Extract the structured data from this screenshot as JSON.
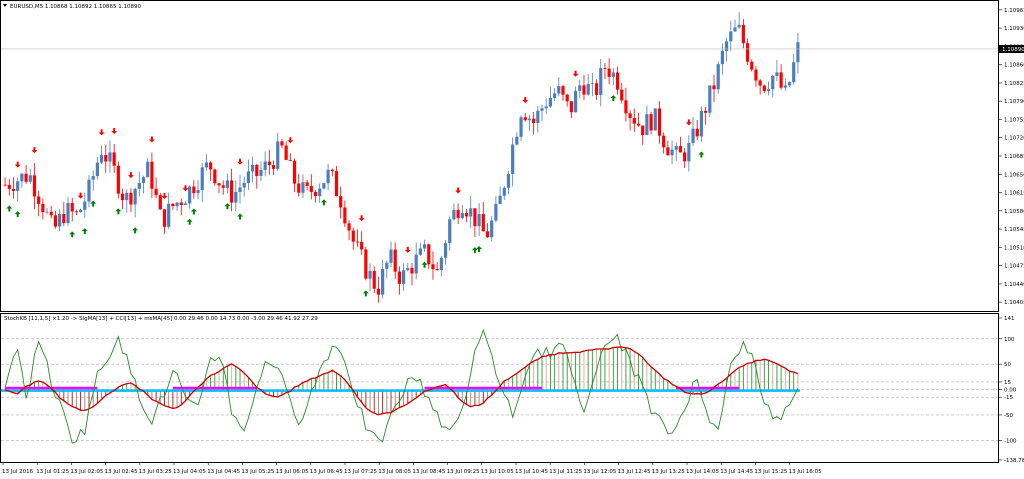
{
  "colors": {
    "bull": "#4a7ebf",
    "bear": "#ff0000",
    "up_arrow": "#008000",
    "down_arrow": "#ff0000",
    "grid": "#9a9a9a",
    "stoch": "#cc0000",
    "cci": "#2a8a2a",
    "hist_pos": "#2e9a2e",
    "hist_neg": "#c01010",
    "signal_pink": "#ff00ff",
    "signal_cyan": "#00bfff",
    "price_tag": "#000000"
  },
  "main": {
    "title": "EURUSD,M5  1.10868 1.10892 1.10865 1.10890",
    "current_price_label": "1.10890",
    "current_price": 1.1089
  },
  "sub": {
    "title": "StochKB [11,1,5] ×1.20 -> SigMA[13] + CCI[13] + msMA[45] 0.00 29.46 0.00 14.73 0.00 -3.00 29.46 41.92 27.29"
  },
  "chart_data": [
    {
      "type": "candlestick",
      "symbol": "EURUSD,M5",
      "ylim": [
        1.1039,
        1.1098
      ],
      "y_tick_labels": [
        "1.10965",
        "1.10930",
        "1.10895",
        "1.10860",
        "1.10825",
        "1.10790",
        "1.10755",
        "1.10720",
        "1.10685",
        "1.10650",
        "1.10615",
        "1.10580",
        "1.10545",
        "1.10510",
        "1.10475",
        "1.10440",
        "1.10405"
      ],
      "close_path": [
        1.1063,
        1.1064,
        1.1065,
        1.106,
        1.1054,
        1.1058,
        1.1057,
        1.1062,
        1.107,
        1.1066,
        1.106,
        1.1063,
        1.1066,
        1.1056,
        1.1059,
        1.1061,
        1.1064,
        1.1067,
        1.1063,
        1.1061,
        1.1064,
        1.1065,
        1.1067,
        1.107,
        1.1064,
        1.1061,
        1.1063,
        1.1065,
        1.106,
        1.1052,
        1.1047,
        1.1043,
        1.1049,
        1.1045,
        1.1048,
        1.105,
        1.1046,
        1.1056,
        1.106,
        1.1057,
        1.1053,
        1.1058,
        1.1068,
        1.1078,
        1.1075,
        1.1079,
        1.1081,
        1.1077,
        1.1083,
        1.108,
        1.1086,
        1.1083,
        1.1077,
        1.1074,
        1.1076,
        1.1071,
        1.1068,
        1.107,
        1.1076,
        1.1082,
        1.109,
        1.1093,
        1.1087,
        1.1082,
        1.1084,
        1.108,
        1.1089
      ],
      "up_arrow_index": [
        1,
        3,
        16,
        19,
        21,
        27,
        31,
        44,
        45,
        53,
        56,
        76,
        86,
        100,
        112,
        113,
        145,
        166
      ],
      "down_arrow_index": [
        3,
        7,
        18,
        23,
        26,
        30,
        35,
        38,
        43,
        56,
        68,
        85,
        96,
        108,
        124,
        136,
        163
      ],
      "x_tick_labels": [
        "13 Jul 2016",
        "13 Jul 01:25",
        "13 Jul 02:05",
        "13 Jul 02:45",
        "13 Jul 03:25",
        "13 Jul 04:05",
        "13 Jul 04:45",
        "13 Jul 05:25",
        "13 Jul 06:05",
        "13 Jul 06:45",
        "13 Jul 07:25",
        "13 Jul 08:05",
        "13 Jul 08:45",
        "13 Jul 09:25",
        "13 Jul 10:05",
        "13 Jul 10:45",
        "13 Jul 11:25",
        "13 Jul 12:05",
        "13 Jul 12:45",
        "13 Jul 13:25",
        "13 Jul 14:05",
        "13 Jul 14:45",
        "13 Jul 15:25",
        "13 Jul 16:05"
      ]
    },
    {
      "type": "line",
      "name": "StochKB / CCI oscillator",
      "ylim": [
        -138.78,
        141
      ],
      "y_tick_labels": [
        {
          "v": 141,
          "t": "141"
        },
        {
          "v": 100,
          "t": "100"
        },
        {
          "v": 50,
          "t": "50"
        },
        {
          "v": 15,
          "t": "15"
        },
        {
          "v": 0,
          "t": "0.00"
        },
        {
          "v": -15,
          "t": "-15"
        },
        {
          "v": -50,
          "t": "-50"
        },
        {
          "v": -100,
          "t": "-100"
        },
        {
          "v": -138.78,
          "t": "-138.78"
        }
      ],
      "stoch_path": [
        0,
        -10,
        8,
        18,
        5,
        -20,
        -35,
        -42,
        -30,
        -10,
        5,
        15,
        0,
        -20,
        -30,
        -40,
        -20,
        5,
        25,
        38,
        50,
        35,
        10,
        -10,
        -15,
        -5,
        10,
        20,
        30,
        38,
        20,
        -10,
        -40,
        -50,
        -45,
        -35,
        -20,
        -5,
        5,
        10,
        -15,
        -35,
        -30,
        -10,
        15,
        30,
        45,
        60,
        68,
        72,
        74,
        75,
        78,
        80,
        82,
        84,
        70,
        45,
        25,
        10,
        -5,
        -10,
        -5,
        10,
        30,
        45,
        55,
        60,
        52,
        40,
        30
      ],
      "cci_path": [
        0,
        80,
        -20,
        110,
        20,
        -40,
        -100,
        -80,
        20,
        60,
        110,
        40,
        -20,
        -60,
        -10,
        40,
        -30,
        -40,
        60,
        70,
        -40,
        -80,
        -20,
        60,
        50,
        -20,
        -60,
        -10,
        50,
        90,
        60,
        -20,
        -80,
        -110,
        -60,
        -10,
        30,
        0,
        -40,
        -90,
        -60,
        20,
        120,
        60,
        -10,
        -50,
        20,
        80,
        70,
        90,
        40,
        -40,
        30,
        80,
        110,
        60,
        20,
        -40,
        -70,
        -90,
        -30,
        20,
        -50,
        -70,
        40,
        90,
        60,
        -20,
        -60,
        -40,
        10
      ]
    }
  ]
}
